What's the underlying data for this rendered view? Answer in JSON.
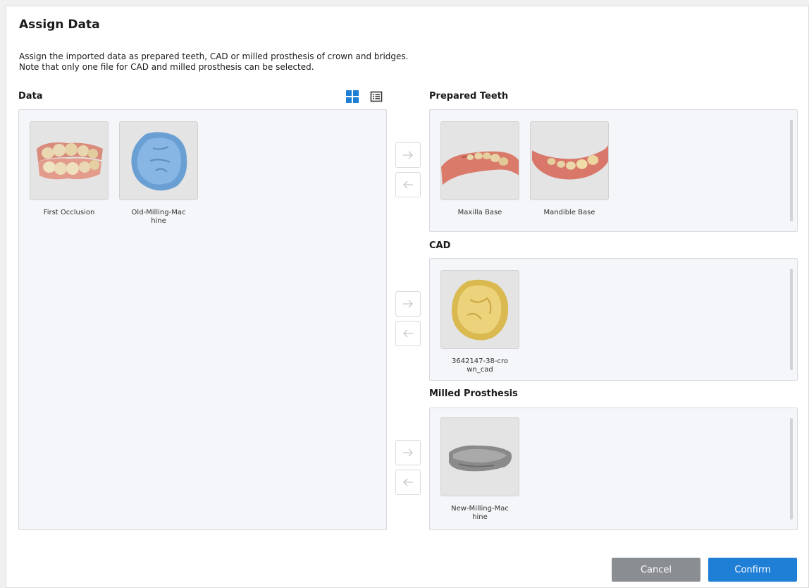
{
  "dialog": {
    "title": "Assign Data",
    "description_line1": "Assign the imported data as prepared teeth, CAD or milled prosthesis of crown and bridges.",
    "description_line2": "Note that only one file for CAD and milled prosthesis can be selected."
  },
  "data_panel": {
    "label": "Data",
    "view_icons": [
      "grid-view-icon",
      "list-view-icon"
    ],
    "items": [
      {
        "label": "First Occlusion",
        "icon": "occlusion-model-icon"
      },
      {
        "label": "Old-Milling-Mac\nhine",
        "icon": "blue-crown-model-icon"
      }
    ]
  },
  "prepared_teeth": {
    "label": "Prepared Teeth",
    "items": [
      {
        "label": "Maxilla Base",
        "icon": "maxilla-scan-icon"
      },
      {
        "label": "Mandible Base",
        "icon": "mandible-scan-icon"
      }
    ]
  },
  "cad": {
    "label": "CAD",
    "items": [
      {
        "label": "3642147-38-cro\nwn_cad",
        "icon": "yellow-crown-model-icon"
      }
    ]
  },
  "milled_prosthesis": {
    "label": "Milled Prosthesis",
    "items": [
      {
        "label": "New-Milling-Mac\nhine",
        "icon": "gray-crown-model-icon"
      }
    ]
  },
  "buttons": {
    "cancel": "Cancel",
    "confirm": "Confirm"
  },
  "colors": {
    "accent": "#1f7fd6",
    "cancel": "#8a8d92",
    "panel_bg": "#f5f6f9"
  }
}
